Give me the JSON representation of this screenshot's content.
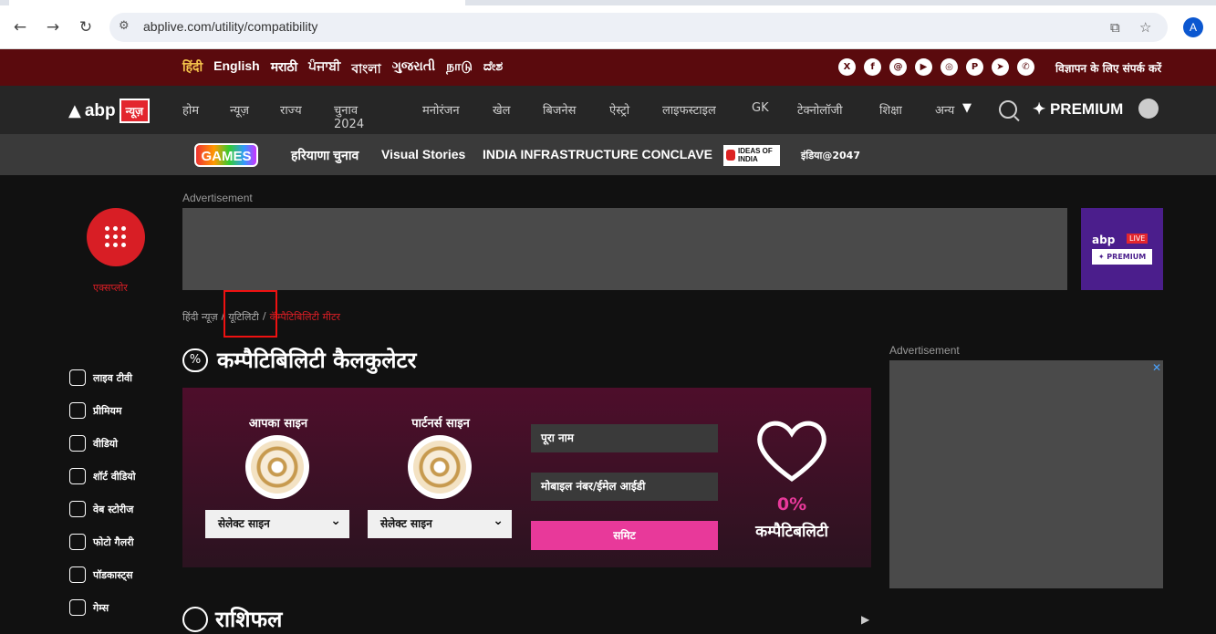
{
  "browser": {
    "url": "abplive.com/utility/compatibility",
    "profile_initial": "A"
  },
  "langbar": {
    "languages": [
      "हिंदी",
      "English",
      "मराठी",
      "ਪੰਜਾਬੀ",
      "বাংলা",
      "ગુજરાતી",
      "நாடு",
      "ದೇಶ"
    ],
    "ad_contact": "विज्ञापन के लिए संपर्क करें"
  },
  "nav": {
    "logo_text": "abp",
    "logo_badge": "न्यूज़",
    "items": [
      "होम",
      "न्यूज़",
      "राज्य",
      "चुनाव 2024",
      "मनोरंजन",
      "खेल",
      "बिजनेस",
      "ऐस्ट्रो",
      "लाइफस्टाइल",
      "GK",
      "टेक्नोलॉजी",
      "शिक्षा",
      "अन्य"
    ],
    "premium": "PREMIUM"
  },
  "subnav": {
    "games_logo": "GAMES",
    "items": [
      "हरियाणा चुनाव",
      "Visual Stories",
      "INDIA INFRASTRUCTURE CONCLAVE"
    ],
    "ideas_logo": "IDEAS OF INDIA",
    "india2047": "इंडिया@2047"
  },
  "explore": {
    "label": "एक्सप्लोर"
  },
  "ads": {
    "label": "Advertisement",
    "promo_brand": "abp",
    "promo_live": "LIVE",
    "promo_premium": "✦ PREMIUM"
  },
  "breadcrumb": [
    "हिंदी न्यूज़",
    "यूटिलिटी",
    "कॅम्पैटिबिलिटी मीटर"
  ],
  "sidemenu": [
    "लाइव टीवी",
    "प्रीमियम",
    "वीडियो",
    "शॉर्ट वीडियो",
    "वेब स्टोरीज",
    "फोटो गैलरी",
    "पॉडकास्ट्स",
    "गेम्स"
  ],
  "page": {
    "title": "कम्पैटिबिलिटी कैलकुलेटर",
    "your_sign": "आपका साइन",
    "partner_sign": "पार्टनर्स साइन",
    "select_sign": "सेलेक्ट साइन",
    "name_placeholder": "पूरा नाम",
    "contact_placeholder": "मोबाइल नंबर/ईमेल आईडी",
    "submit": "समिट",
    "percent": "0%",
    "compat_label": "कम्पैटिबलिटी",
    "next_section": "राशिफल"
  }
}
